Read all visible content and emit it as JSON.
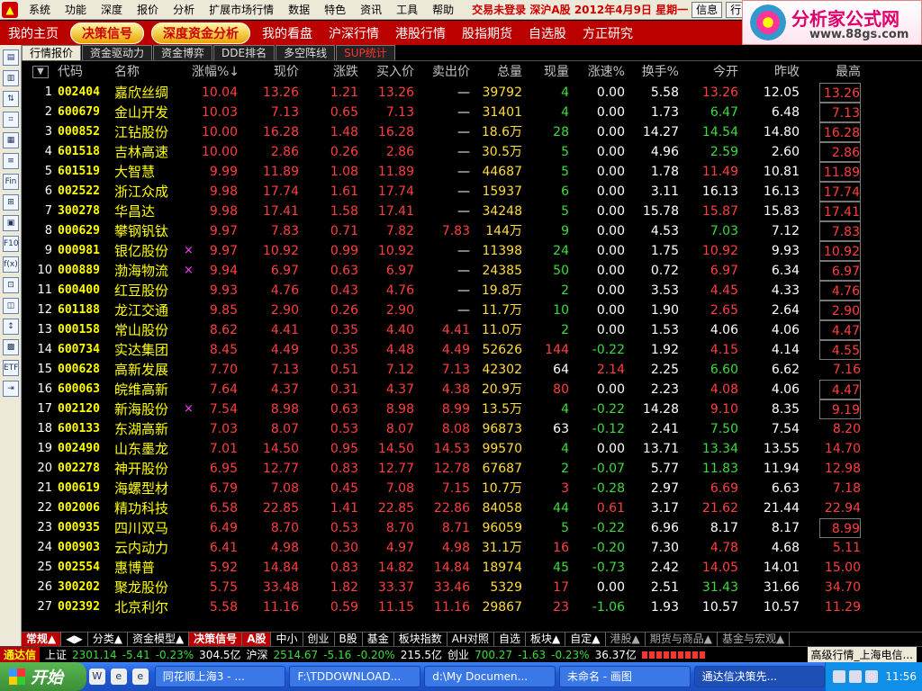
{
  "menubar": {
    "items": [
      "系统",
      "功能",
      "深度",
      "报价",
      "分析",
      "扩展市场行情",
      "数据",
      "特色",
      "资讯",
      "工具",
      "帮助"
    ],
    "status": "交易未登录 深沪A股 2012年4月9日 星期一",
    "info_btn": "信息",
    "row_btn": "行"
  },
  "brand": {
    "title": "分析家公式网",
    "url": "www.88gs.com"
  },
  "nav": {
    "items": [
      "我的主页",
      "决策信号",
      "深度资金分析",
      "我的看盘",
      "沪深行情",
      "港股行情",
      "股指期货",
      "自选股",
      "方正研究"
    ]
  },
  "lefttoolbar": {
    "icons": [
      "▤",
      "▥",
      "⇅",
      "⌗",
      "▦",
      "≡",
      "Fin",
      "⊞",
      "▣",
      "F10",
      "f(x)",
      "⊡",
      "◫",
      "↕",
      "▩",
      "ETF",
      "⇥"
    ]
  },
  "tabs": [
    "行情报价",
    "资金驱动力",
    "资金博弈",
    "DDE排名",
    "多空阵线",
    "SUP统计"
  ],
  "table": {
    "headers": [
      "代码",
      "名称",
      "涨幅%↓",
      "现价",
      "涨跌",
      "买入价",
      "卖出价",
      "总量",
      "现量",
      "涨速%",
      "换手%",
      "今开",
      "昨收",
      "最高"
    ],
    "rows": [
      {
        "i": "1",
        "code": "002404",
        "name": "嘉欣丝绸",
        "mark": "",
        "chg": "10.04",
        "price": "13.26",
        "diff": "1.21",
        "bid": "13.26",
        "ask": "—",
        "vol": "39792",
        "cur": "4",
        "spd": "0.00",
        "turn": "5.58",
        "open": "13.26",
        "prev": "12.05",
        "high": "13.26"
      },
      {
        "i": "2",
        "code": "600679",
        "name": "金山开发",
        "mark": "",
        "chg": "10.03",
        "price": "7.13",
        "diff": "0.65",
        "bid": "7.13",
        "ask": "—",
        "vol": "31401",
        "cur": "4",
        "spd": "0.00",
        "turn": "1.73",
        "open": "6.47",
        "prev": "6.48",
        "high": "7.13"
      },
      {
        "i": "3",
        "code": "000852",
        "name": "江钻股份",
        "mark": "",
        "chg": "10.00",
        "price": "16.28",
        "diff": "1.48",
        "bid": "16.28",
        "ask": "—",
        "vol": "18.6万",
        "cur": "28",
        "spd": "0.00",
        "turn": "14.27",
        "open": "14.54",
        "prev": "14.80",
        "high": "16.28"
      },
      {
        "i": "4",
        "code": "601518",
        "name": "吉林高速",
        "mark": "",
        "chg": "10.00",
        "price": "2.86",
        "diff": "0.26",
        "bid": "2.86",
        "ask": "—",
        "vol": "30.5万",
        "cur": "5",
        "spd": "0.00",
        "turn": "4.96",
        "open": "2.59",
        "prev": "2.60",
        "high": "2.86"
      },
      {
        "i": "5",
        "code": "601519",
        "name": "大智慧",
        "mark": "",
        "chg": "9.99",
        "price": "11.89",
        "diff": "1.08",
        "bid": "11.89",
        "ask": "—",
        "vol": "44687",
        "cur": "5",
        "spd": "0.00",
        "turn": "1.78",
        "open": "11.49",
        "prev": "10.81",
        "high": "11.89"
      },
      {
        "i": "6",
        "code": "002522",
        "name": "浙江众成",
        "mark": "",
        "chg": "9.98",
        "price": "17.74",
        "diff": "1.61",
        "bid": "17.74",
        "ask": "—",
        "vol": "15937",
        "cur": "6",
        "spd": "0.00",
        "turn": "3.11",
        "open": "16.13",
        "prev": "16.13",
        "high": "17.74"
      },
      {
        "i": "7",
        "code": "300278",
        "name": "华昌达",
        "mark": "",
        "chg": "9.98",
        "price": "17.41",
        "diff": "1.58",
        "bid": "17.41",
        "ask": "—",
        "vol": "34248",
        "cur": "5",
        "spd": "0.00",
        "turn": "15.78",
        "open": "15.87",
        "prev": "15.83",
        "high": "17.41"
      },
      {
        "i": "8",
        "code": "000629",
        "name": "攀钢钒钛",
        "mark": "",
        "chg": "9.97",
        "price": "7.83",
        "diff": "0.71",
        "bid": "7.82",
        "ask": "7.83",
        "vol": "144万",
        "cur": "9",
        "spd": "0.00",
        "turn": "4.53",
        "open": "7.03",
        "prev": "7.12",
        "high": "7.83"
      },
      {
        "i": "9",
        "code": "000981",
        "name": "银亿股份",
        "mark": "×",
        "chg": "9.97",
        "price": "10.92",
        "diff": "0.99",
        "bid": "10.92",
        "ask": "—",
        "vol": "11398",
        "cur": "24",
        "spd": "0.00",
        "turn": "1.75",
        "open": "10.92",
        "prev": "9.93",
        "high": "10.92"
      },
      {
        "i": "10",
        "code": "000889",
        "name": "渤海物流",
        "mark": "×",
        "chg": "9.94",
        "price": "6.97",
        "diff": "0.63",
        "bid": "6.97",
        "ask": "—",
        "vol": "24385",
        "cur": "50",
        "spd": "0.00",
        "turn": "0.72",
        "open": "6.97",
        "prev": "6.34",
        "high": "6.97"
      },
      {
        "i": "11",
        "code": "600400",
        "name": "红豆股份",
        "mark": "",
        "chg": "9.93",
        "price": "4.76",
        "diff": "0.43",
        "bid": "4.76",
        "ask": "—",
        "vol": "19.8万",
        "cur": "2",
        "spd": "0.00",
        "turn": "3.53",
        "open": "4.45",
        "prev": "4.33",
        "high": "4.76"
      },
      {
        "i": "12",
        "code": "601188",
        "name": "龙江交通",
        "mark": "",
        "chg": "9.85",
        "price": "2.90",
        "diff": "0.26",
        "bid": "2.90",
        "ask": "—",
        "vol": "11.7万",
        "cur": "10",
        "spd": "0.00",
        "turn": "1.90",
        "open": "2.65",
        "prev": "2.64",
        "high": "2.90"
      },
      {
        "i": "13",
        "code": "000158",
        "name": "常山股份",
        "mark": "",
        "chg": "8.62",
        "price": "4.41",
        "diff": "0.35",
        "bid": "4.40",
        "ask": "4.41",
        "vol": "11.0万",
        "cur": "2",
        "spd": "0.00",
        "turn": "1.53",
        "open": "4.06",
        "prev": "4.06",
        "high": "4.47"
      },
      {
        "i": "14",
        "code": "600734",
        "name": "实达集团",
        "mark": "",
        "chg": "8.45",
        "price": "4.49",
        "diff": "0.35",
        "bid": "4.48",
        "ask": "4.49",
        "vol": "52626",
        "cur": "144",
        "spd": "-0.22",
        "turn": "1.92",
        "open": "4.15",
        "prev": "4.14",
        "high": "4.55"
      },
      {
        "i": "15",
        "code": "000628",
        "name": "高新发展",
        "mark": "",
        "chg": "7.70",
        "price": "7.13",
        "diff": "0.51",
        "bid": "7.12",
        "ask": "7.13",
        "vol": "42302",
        "cur": "64",
        "spd": "2.14",
        "turn": "2.25",
        "open": "6.60",
        "prev": "6.62",
        "high": "7.16"
      },
      {
        "i": "16",
        "code": "600063",
        "name": "皖维高新",
        "mark": "",
        "chg": "7.64",
        "price": "4.37",
        "diff": "0.31",
        "bid": "4.37",
        "ask": "4.38",
        "vol": "20.9万",
        "cur": "80",
        "spd": "0.00",
        "turn": "2.23",
        "open": "4.08",
        "prev": "4.06",
        "high": "4.47"
      },
      {
        "i": "17",
        "code": "002120",
        "name": "新海股份",
        "mark": "×",
        "chg": "7.54",
        "price": "8.98",
        "diff": "0.63",
        "bid": "8.98",
        "ask": "8.99",
        "vol": "13.5万",
        "cur": "4",
        "spd": "-0.22",
        "turn": "14.28",
        "open": "9.10",
        "prev": "8.35",
        "high": "9.19"
      },
      {
        "i": "18",
        "code": "600133",
        "name": "东湖高新",
        "mark": "",
        "chg": "7.03",
        "price": "8.07",
        "diff": "0.53",
        "bid": "8.07",
        "ask": "8.08",
        "vol": "96873",
        "cur": "63",
        "spd": "-0.12",
        "turn": "2.41",
        "open": "7.50",
        "prev": "7.54",
        "high": "8.20"
      },
      {
        "i": "19",
        "code": "002490",
        "name": "山东墨龙",
        "mark": "",
        "chg": "7.01",
        "price": "14.50",
        "diff": "0.95",
        "bid": "14.50",
        "ask": "14.53",
        "vol": "99570",
        "cur": "4",
        "spd": "0.00",
        "turn": "13.71",
        "open": "13.34",
        "prev": "13.55",
        "high": "14.70"
      },
      {
        "i": "20",
        "code": "002278",
        "name": "神开股份",
        "mark": "",
        "chg": "6.95",
        "price": "12.77",
        "diff": "0.83",
        "bid": "12.77",
        "ask": "12.78",
        "vol": "67687",
        "cur": "2",
        "spd": "-0.07",
        "turn": "5.77",
        "open": "11.83",
        "prev": "11.94",
        "high": "12.98"
      },
      {
        "i": "21",
        "code": "000619",
        "name": "海螺型材",
        "mark": "",
        "chg": "6.79",
        "price": "7.08",
        "diff": "0.45",
        "bid": "7.08",
        "ask": "7.15",
        "vol": "10.7万",
        "cur": "3",
        "spd": "-0.28",
        "turn": "2.97",
        "open": "6.69",
        "prev": "6.63",
        "high": "7.18"
      },
      {
        "i": "22",
        "code": "002006",
        "name": "精功科技",
        "mark": "",
        "chg": "6.58",
        "price": "22.85",
        "diff": "1.41",
        "bid": "22.85",
        "ask": "22.86",
        "vol": "84058",
        "cur": "44",
        "spd": "0.61",
        "turn": "3.17",
        "open": "21.62",
        "prev": "21.44",
        "high": "22.94"
      },
      {
        "i": "23",
        "code": "000935",
        "name": "四川双马",
        "mark": "",
        "chg": "6.49",
        "price": "8.70",
        "diff": "0.53",
        "bid": "8.70",
        "ask": "8.71",
        "vol": "96059",
        "cur": "5",
        "spd": "-0.22",
        "turn": "6.96",
        "open": "8.17",
        "prev": "8.17",
        "high": "8.99"
      },
      {
        "i": "24",
        "code": "000903",
        "name": "云内动力",
        "mark": "",
        "chg": "6.41",
        "price": "4.98",
        "diff": "0.30",
        "bid": "4.97",
        "ask": "4.98",
        "vol": "31.1万",
        "cur": "16",
        "spd": "-0.20",
        "turn": "7.30",
        "open": "4.78",
        "prev": "4.68",
        "high": "5.11"
      },
      {
        "i": "25",
        "code": "002554",
        "name": "惠博普",
        "mark": "",
        "chg": "5.92",
        "price": "14.84",
        "diff": "0.83",
        "bid": "14.82",
        "ask": "14.84",
        "vol": "18974",
        "cur": "45",
        "spd": "-0.73",
        "turn": "2.42",
        "open": "14.05",
        "prev": "14.01",
        "high": "15.00"
      },
      {
        "i": "26",
        "code": "300202",
        "name": "聚龙股份",
        "mark": "",
        "chg": "5.75",
        "price": "33.48",
        "diff": "1.82",
        "bid": "33.37",
        "ask": "33.46",
        "vol": "5329",
        "cur": "17",
        "spd": "0.00",
        "turn": "2.51",
        "open": "31.43",
        "prev": "31.66",
        "high": "34.70"
      },
      {
        "i": "27",
        "code": "002392",
        "name": "北京利尔",
        "mark": "",
        "chg": "5.58",
        "price": "11.16",
        "diff": "0.59",
        "bid": "11.15",
        "ask": "11.16",
        "vol": "29867",
        "cur": "23",
        "spd": "-1.06",
        "turn": "1.93",
        "open": "10.57",
        "prev": "10.57",
        "high": "11.29"
      }
    ]
  },
  "categories": [
    "常规▲",
    "◀▶",
    "分类▲",
    "资金模型▲",
    "决策信号",
    "A股",
    "中小",
    "创业",
    "B股",
    "基金",
    "板块指数",
    "AH对照",
    "自选",
    "板块▲",
    "自定▲",
    "港股▲",
    "期货与商品▲",
    "基金与宏观▲"
  ],
  "ticker": {
    "brand": "通达信",
    "sh_label": "上证",
    "sh_val": "2301.14",
    "sh_chg": "-5.41",
    "sh_pct": "-0.23%",
    "sh_amt": "304.5亿",
    "sz_label": "沪深",
    "sz_val": "2514.67",
    "sz_chg": "-5.16",
    "sz_pct": "-0.20%",
    "sz_amt": "215.5亿",
    "cy_label": "创业",
    "cy_val": "700.27",
    "cy_chg": "-1.63",
    "cy_pct": "-0.23%",
    "cy_amt": "36.37亿",
    "feed": "高级行情_上海电信..."
  },
  "taskbar": {
    "start": "开始",
    "quick": [
      "W",
      "e",
      "e"
    ],
    "tasks": [
      "同花顺上海3 - ...",
      "F:\\TDDOWNLOAD...",
      "d:\\My Documen...",
      "未命名 - 画图",
      "通达信决策先..."
    ],
    "clock": "11:56"
  }
}
